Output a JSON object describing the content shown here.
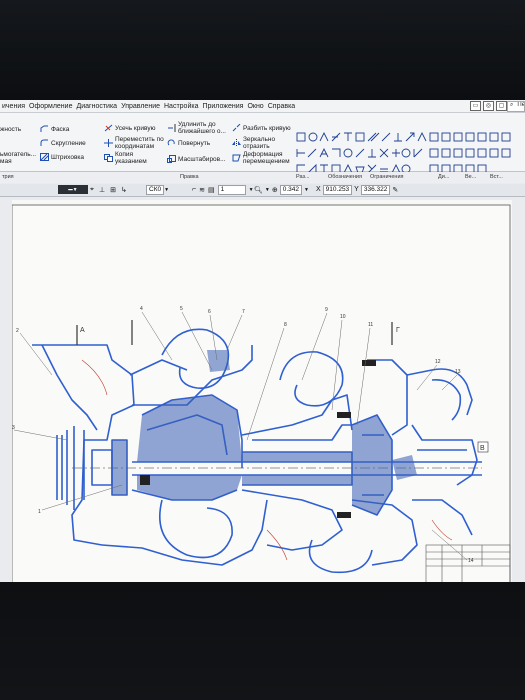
{
  "menu": {
    "items": [
      "Оформление",
      "Диагностика",
      "Управление",
      "Настройка",
      "Приложения",
      "Окно",
      "Справка"
    ],
    "cut_left": "ичения",
    "search_label": "Пе"
  },
  "ribbon": {
    "cmd_partial_1": "жность",
    "cmd_partial_2": "мметрия",
    "cmd_partial_3": "ьмогатель...",
    "cmd_partial_4": "мая",
    "cmd_faska": "Фаска",
    "cmd_skruglenie": "Скругление",
    "cmd_shtrikhovka": "Штриховка",
    "cmd_usech": "Усечь кривую",
    "cmd_peremestit": "Переместить по координатам",
    "cmd_kopiya": "Копия указанием",
    "cmd_udlinit": "Удлинить до ближайшего о...",
    "cmd_povernut": "Повернуть",
    "cmd_masshtab": "Масштабиров...",
    "cmd_razbit": "Разбить кривую",
    "cmd_zerkalno": "Зеркально отразить",
    "cmd_deformaciya": "Деформация перемещением",
    "group_pravka": "Правка",
    "group_geometriya": "трия",
    "strip_labels": [
      "Раз...",
      "Обозначения",
      "Ограничения",
      "Ди...",
      "Ве...",
      "Вст..."
    ]
  },
  "toolbar": {
    "cs_name": "СК0",
    "layer_num": "1",
    "zoom": "0.342",
    "x_label": "X",
    "x_value": "910.253",
    "y_label": "Y",
    "y_value": "336.322"
  },
  "drawing": {
    "section_a": "А",
    "section_b": "Б",
    "section_v": "В",
    "section_g": "Г",
    "leader_numbers": [
      "1",
      "2",
      "3",
      "4",
      "5",
      "6",
      "7",
      "8",
      "9",
      "10",
      "11",
      "12",
      "13",
      "14"
    ]
  },
  "colors": {
    "drawing_line": "#2f5fd0",
    "hatch": "#3b5fb5",
    "leader": "#6b6b6b",
    "accent_red": "#c0392b"
  }
}
